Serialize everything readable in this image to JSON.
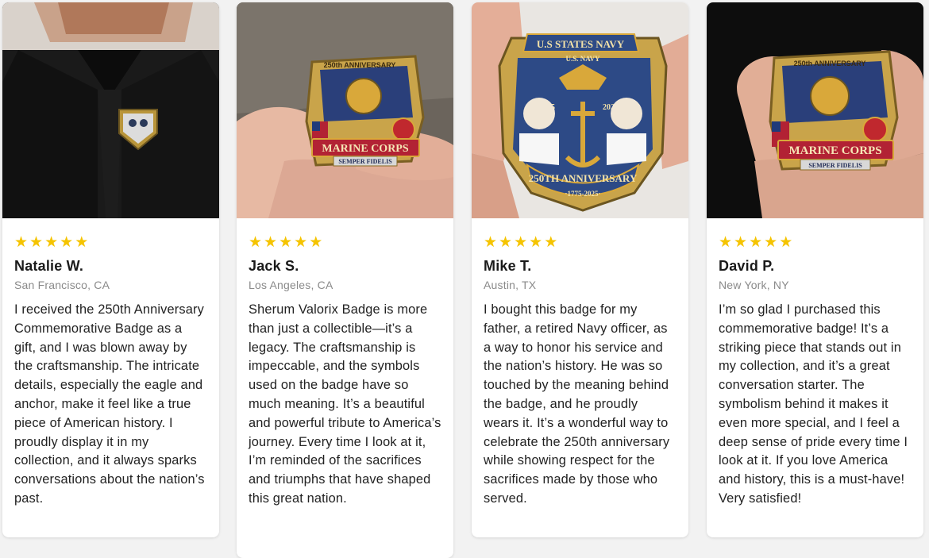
{
  "colors": {
    "star": "#f5c400",
    "card_bg": "#ffffff",
    "page_bg": "#f2f2f2"
  },
  "reviews": [
    {
      "rating": 5,
      "stars": [
        "★",
        "★",
        "★",
        "★",
        "★"
      ],
      "name": "Natalie W.",
      "location": "San Francisco, CA",
      "text": "I received the 250th Anniversary Commemorative Badge as a gift, and I was blown away by the craftsmanship. The intricate details, especially the eagle and anchor, make it feel like a true piece of American history. I proudly display it in my collection, and it always sparks conversations about the nation’s past."
    },
    {
      "rating": 5,
      "stars": [
        "★",
        "★",
        "★",
        "★",
        "★"
      ],
      "name": "Jack S.",
      "location": "Los Angeles, CA",
      "text": "Sherum Valorix Badge is more than just a collectible—it’s a legacy. The craftsmanship is impeccable, and the symbols used on the badge have so much meaning. It’s a beautiful and powerful tribute to America’s journey. Every time I look at it, I’m reminded of the sacrifices and triumphs that have shaped this great nation.",
      "badge": {
        "top": "250th ANNIVERSARY",
        "main": "MARINE CORPS",
        "sub": "SEMPER FIDELIS"
      }
    },
    {
      "rating": 5,
      "stars": [
        "★",
        "★",
        "★",
        "★",
        "★"
      ],
      "name": "Mike T.",
      "location": "Austin, TX",
      "text": "I bought this badge for my father, a retired Navy officer, as a way to honor his service and the nation’s history. He was so touched by the meaning behind the badge, and he proudly wears it. It’s a wonderful way to celebrate the 250th anniversary while showing respect for the sacrifices made by those who served.",
      "badge": {
        "top": "U.S STATES NAVY",
        "sub_top": "U.S. NAVY",
        "year_left": "1775",
        "year_right": "2025",
        "main": "250TH ANNIVERSARY",
        "bottom": "·1775-2025·"
      }
    },
    {
      "rating": 5,
      "stars": [
        "★",
        "★",
        "★",
        "★",
        "★"
      ],
      "name": "David P.",
      "location": "New York, NY",
      "text": "I’m so glad I purchased this commemorative badge! It’s a striking piece that stands out in my collection, and it’s a great conversation starter. The symbolism behind it makes it even more special, and I feel a deep sense of pride every time I look at it. If you love America and history, this is a must-have! Very satisfied!",
      "badge": {
        "top": "250th ANNIVERSARY",
        "main": "MARINE CORPS",
        "sub": "SEMPER FIDELIS"
      }
    }
  ]
}
